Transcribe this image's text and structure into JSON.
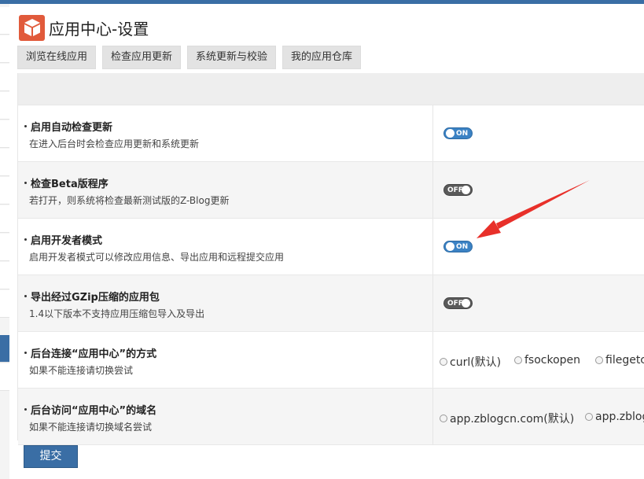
{
  "header": {
    "title": "应用中心-设置",
    "logo_icon": "box-icon",
    "logo_color": "#e15a3b"
  },
  "tabs": [
    {
      "label": "浏览在线应用"
    },
    {
      "label": "检查应用更新"
    },
    {
      "label": "系统更新与校验"
    },
    {
      "label": "我的应用仓库"
    }
  ],
  "settings": [
    {
      "title": "启用自动检查更新",
      "desc": "在进入后台时会检查应用更新和系统更新",
      "toggle": "ON",
      "state": "on"
    },
    {
      "title": "检查Beta版程序",
      "desc": "若打开，则系统将检查最新测试版的Z-Blog更新",
      "toggle": "OFF",
      "state": "off"
    },
    {
      "title": "启用开发者模式",
      "desc": "启用开发者模式可以修改应用信息、导出应用和远程提交应用",
      "toggle": "ON",
      "state": "on"
    },
    {
      "title": "导出经过GZip压缩的应用包",
      "desc": "1.4以下版本不支持应用压缩包导入及导出",
      "toggle": "OFF",
      "state": "off"
    },
    {
      "title": "后台连接“应用中心”的方式",
      "desc": "如果不能连接请切换尝试",
      "options": [
        "curl(默认)",
        "fsockopen",
        "filegetc"
      ]
    },
    {
      "title": "后台访问“应用中心”的域名",
      "desc": "如果不能连接请切换域名尝试",
      "options": [
        "app.zblogcn.com(默认)",
        "app.zblog"
      ]
    }
  ],
  "submit_label": "提交",
  "colors": {
    "accent": "#3a6ea5",
    "toggle_on": "#3b82c4",
    "toggle_off": "#5a5a5a",
    "arrow": "#e8302a"
  }
}
